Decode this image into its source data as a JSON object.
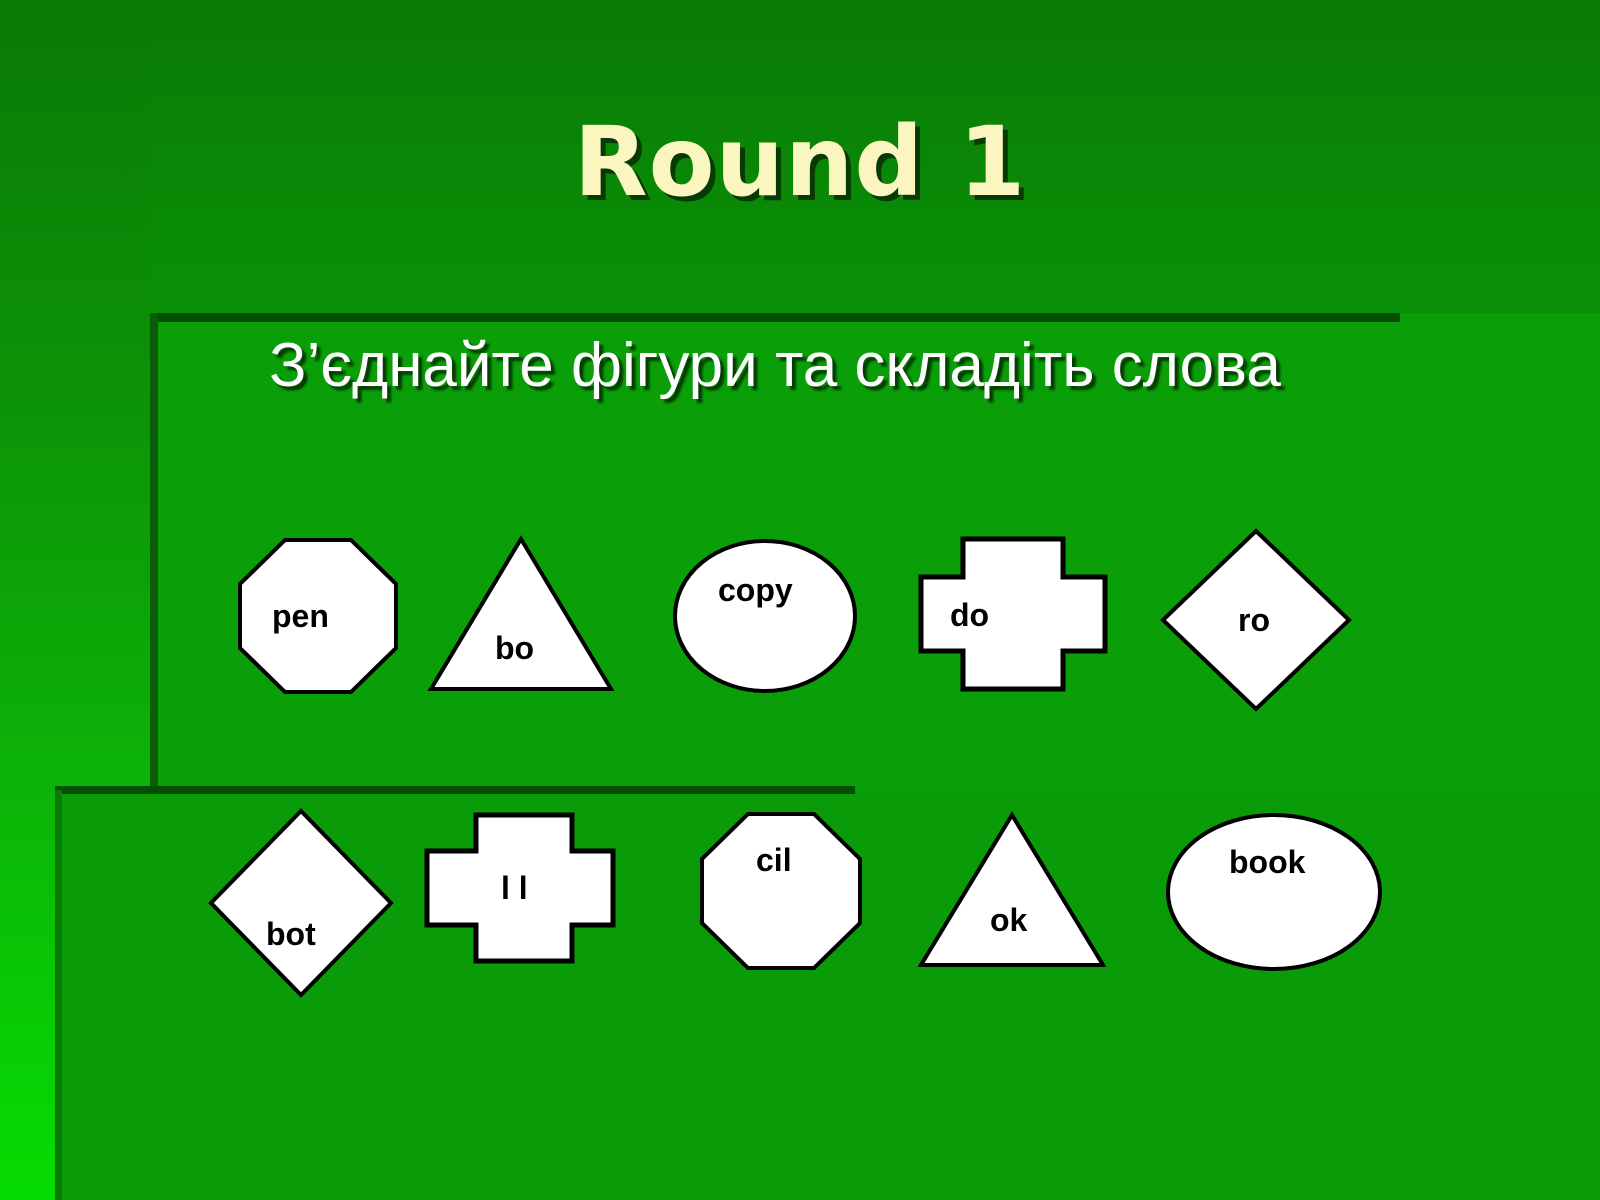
{
  "slide": {
    "title": "Round 1",
    "subtitle": "З’єднайте фігури та складіть слова",
    "colors": {
      "background_top": "#0a7a06",
      "background_bottom": "#05dd02",
      "panel": "#0a9e08",
      "title_text": "#fbf6c0",
      "subtitle_text": "#ffffff",
      "shape_fill": "#ffffff",
      "shape_stroke": "#000000",
      "shape_label": "#000000",
      "rule_dark": "#044d03"
    }
  },
  "rows": [
    {
      "name": "row-1",
      "shapes": [
        {
          "kind": "octagon",
          "label": "pen"
        },
        {
          "kind": "triangle",
          "label": "bo"
        },
        {
          "kind": "ellipse",
          "label": "copy"
        },
        {
          "kind": "cross",
          "label": "do"
        },
        {
          "kind": "diamond",
          "label": "ro"
        }
      ]
    },
    {
      "name": "row-2",
      "shapes": [
        {
          "kind": "diamond",
          "label": "bot"
        },
        {
          "kind": "cross",
          "label": "l l"
        },
        {
          "kind": "octagon",
          "label": "cil"
        },
        {
          "kind": "triangle",
          "label": "ok"
        },
        {
          "kind": "ellipse",
          "label": "book"
        }
      ]
    }
  ]
}
